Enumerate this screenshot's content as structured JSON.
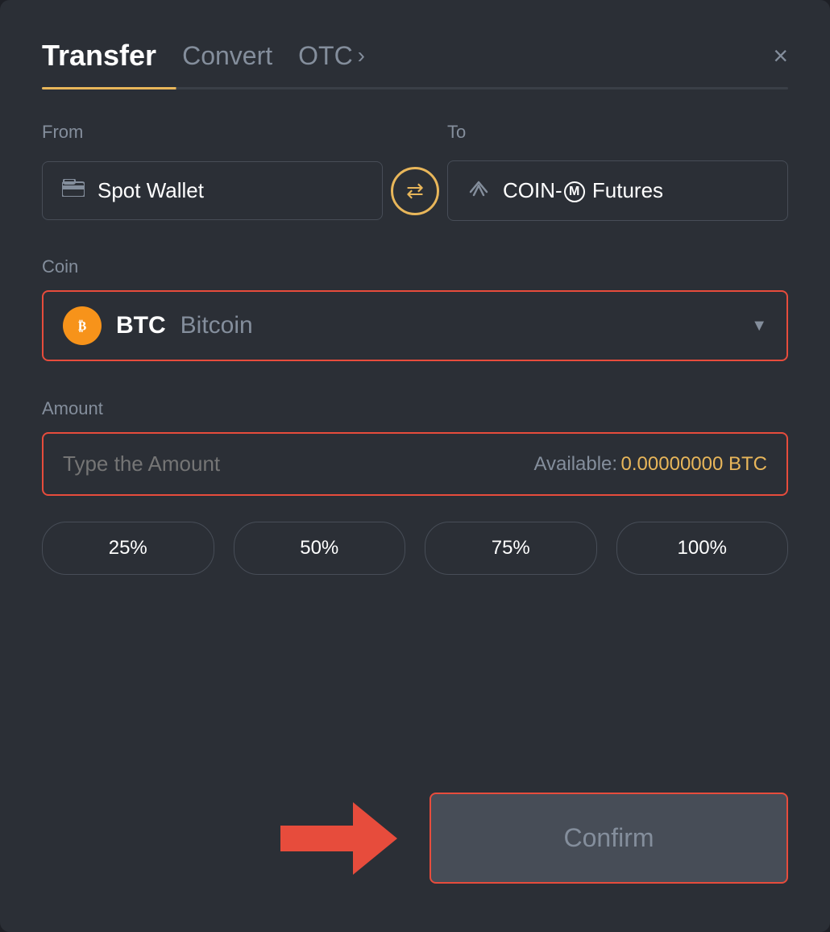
{
  "modal": {
    "title": "Transfer"
  },
  "header": {
    "tab_transfer": "Transfer",
    "tab_convert": "Convert",
    "tab_otc": "OTC",
    "tab_otc_chevron": "›",
    "close_label": "×"
  },
  "from_section": {
    "label": "From",
    "wallet": "Spot Wallet"
  },
  "to_section": {
    "label": "To",
    "wallet": "COIN-M Futures"
  },
  "coin_section": {
    "label": "Coin",
    "coin_symbol": "BTC",
    "coin_name": "Bitcoin"
  },
  "amount_section": {
    "label": "Amount",
    "placeholder": "Type the Amount",
    "available_label": "Available:",
    "available_amount": "0.00000000 BTC"
  },
  "percent_buttons": [
    "25%",
    "50%",
    "75%",
    "100%"
  ],
  "confirm_button": "Confirm",
  "swap_icon": "⇄",
  "btc_icon_symbol": "₿"
}
